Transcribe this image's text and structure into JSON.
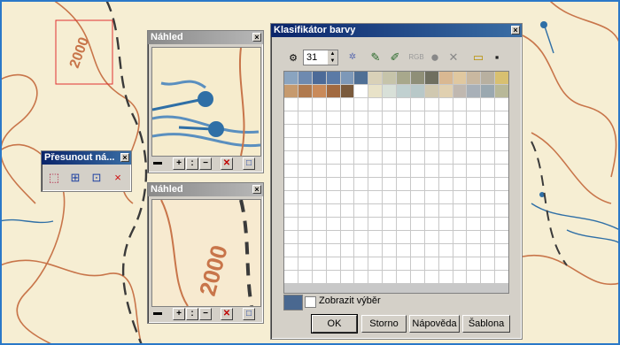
{
  "map": {
    "label_1": "2000",
    "label_2": "2000",
    "label_3": "2000"
  },
  "preview_top": {
    "title": "Náhled"
  },
  "preview_bottom": {
    "title": "Náhled"
  },
  "move_window": {
    "title": "Přesunout ná..."
  },
  "classifier": {
    "title": "Klasifikátor barvy",
    "count_value": "31",
    "rgb_label": "RGB",
    "show_selection_label": "Zobrazit výběr",
    "ok_label": "OK",
    "cancel_label": "Storno",
    "help_label": "Nápověda",
    "template_label": "Šablona",
    "swatches_row1": [
      "#8aa4c0",
      "#6e8ab0",
      "#4c6a98",
      "#5b7aa6",
      "#7d98b8",
      "#4f6f95",
      "#d9d1b8",
      "#c6c4aa",
      "#a8a88c",
      "#8f8f78",
      "#6f6f60",
      "#d9b892",
      "#e0c8a0",
      "#c9b8a0",
      "#b8b0a0",
      "#d8c070"
    ],
    "swatches_row2": [
      "#c69a6e",
      "#b07a4e",
      "#c98a5a",
      "#a26a40",
      "#7a5a3c",
      "",
      "#e8e2c8",
      "#d8e0d8",
      "#c0d0d0",
      "#b8c8c8",
      "#d0c8b0",
      "#e0d0b0",
      "#c0b8b0",
      "#a8b0b8",
      "#9aa8b0",
      "#b8b898"
    ],
    "selected_color": "#4a6890",
    "colors": {
      "accent": "#0a246a",
      "map_contour": "#c8754a",
      "map_river": "#2f6fa6"
    }
  }
}
